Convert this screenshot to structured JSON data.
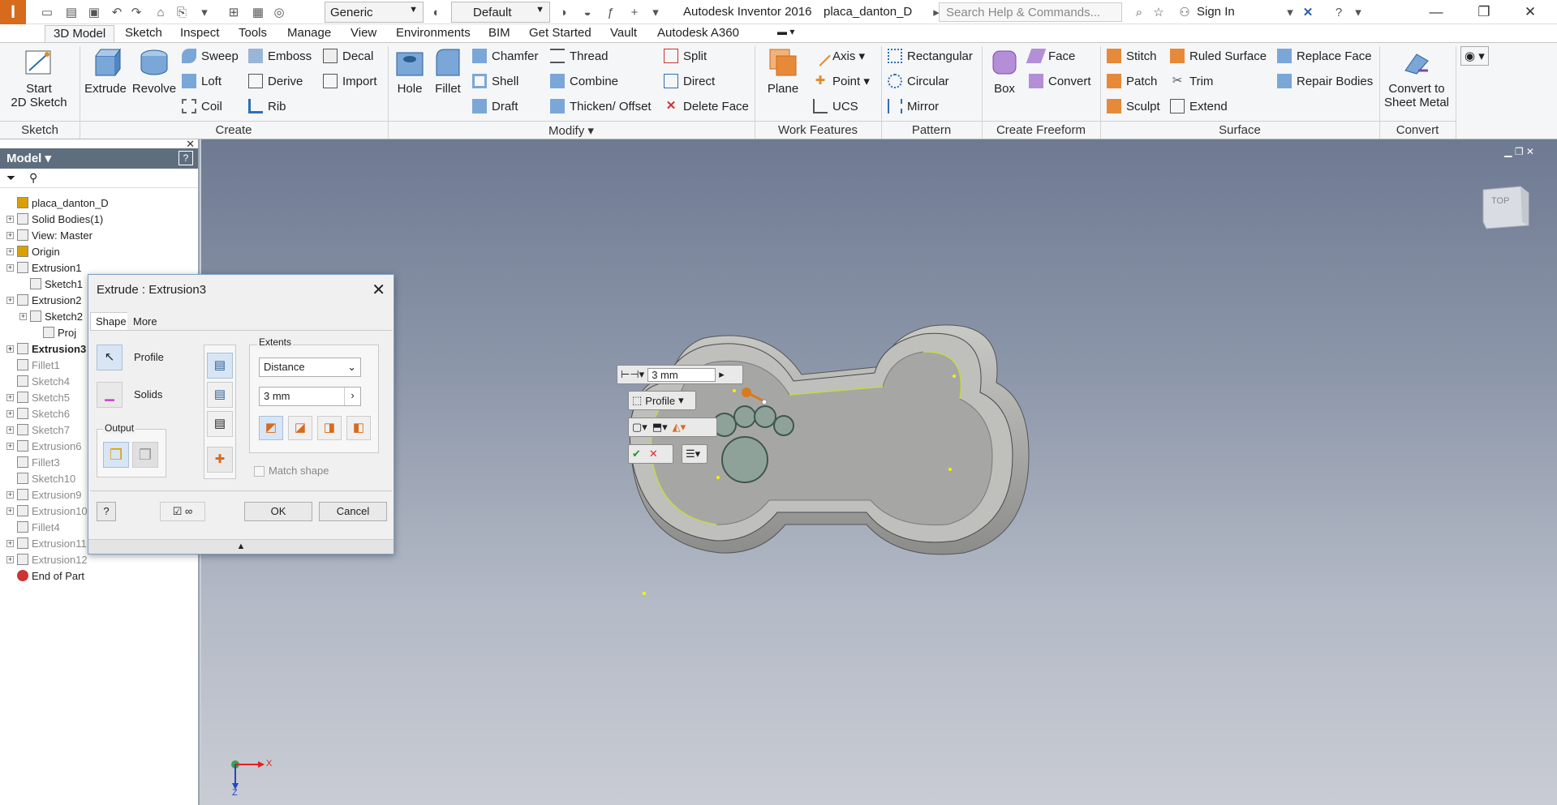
{
  "app": {
    "title": "Autodesk Inventor 2016",
    "document": "placa_danton_D",
    "search_placeholder": "Search Help & Commands...",
    "sign_in": "Sign In",
    "material_select": "Generic",
    "appearance_select": "Default"
  },
  "ribbon_tabs": [
    "3D Model",
    "Sketch",
    "Inspect",
    "Tools",
    "Manage",
    "View",
    "Environments",
    "BIM",
    "Get Started",
    "Vault",
    "Autodesk A360"
  ],
  "ribbon": {
    "sketch": {
      "start_sketch_line1": "Start",
      "start_sketch_line2": "2D Sketch",
      "panel": "Sketch"
    },
    "create": {
      "extrude": "Extrude",
      "revolve": "Revolve",
      "sweep": "Sweep",
      "loft": "Loft",
      "coil": "Coil",
      "emboss": "Emboss",
      "derive": "Derive",
      "rib": "Rib",
      "decal": "Decal",
      "import": "Import",
      "panel": "Create"
    },
    "modify": {
      "hole": "Hole",
      "fillet": "Fillet",
      "chamfer": "Chamfer",
      "shell": "Shell",
      "draft": "Draft",
      "thread": "Thread",
      "combine": "Combine",
      "thicken": "Thicken/ Offset",
      "split": "Split",
      "direct": "Direct",
      "delete_face": "Delete Face",
      "panel": "Modify"
    },
    "work_features": {
      "plane": "Plane",
      "axis": "Axis",
      "point": "Point",
      "ucs": "UCS",
      "panel": "Work Features"
    },
    "pattern": {
      "rectangular": "Rectangular",
      "circular": "Circular",
      "mirror": "Mirror",
      "panel": "Pattern"
    },
    "freeform": {
      "box": "Box",
      "face": "Face",
      "convert": "Convert",
      "panel": "Create Freeform"
    },
    "surface": {
      "stitch": "Stitch",
      "patch": "Patch",
      "sculpt": "Sculpt",
      "ruled_surface": "Ruled Surface",
      "trim": "Trim",
      "extend": "Extend",
      "replace_face": "Replace Face",
      "repair_bodies": "Repair Bodies",
      "panel": "Surface"
    },
    "convert": {
      "line1": "Convert to",
      "line2": "Sheet Metal",
      "panel": "Convert"
    }
  },
  "browser": {
    "title": "Model",
    "nodes": [
      {
        "label": "placa_danton_D",
        "style": "normal"
      },
      {
        "label": "Solid Bodies(1)",
        "style": "normal"
      },
      {
        "label": "View: Master",
        "style": "normal"
      },
      {
        "label": "Origin",
        "style": "normal"
      },
      {
        "label": "Extrusion1",
        "style": "normal"
      },
      {
        "label": "Sketch1",
        "style": "normal"
      },
      {
        "label": "Extrusion2",
        "style": "normal"
      },
      {
        "label": "Sketch2",
        "style": "normal"
      },
      {
        "label": "Proj",
        "style": "normal"
      },
      {
        "label": "Extrusion3",
        "style": "bold"
      },
      {
        "label": "Fillet1",
        "style": "grey"
      },
      {
        "label": "Sketch4",
        "style": "grey"
      },
      {
        "label": "Sketch5",
        "style": "grey"
      },
      {
        "label": "Sketch6",
        "style": "grey"
      },
      {
        "label": "Sketch7",
        "style": "grey"
      },
      {
        "label": "Extrusion6",
        "style": "grey"
      },
      {
        "label": "Fillet3",
        "style": "grey"
      },
      {
        "label": "Sketch10",
        "style": "grey"
      },
      {
        "label": "Extrusion9",
        "style": "grey"
      },
      {
        "label": "Extrusion10",
        "style": "grey"
      },
      {
        "label": "Fillet4",
        "style": "grey"
      },
      {
        "label": "Extrusion11",
        "style": "grey"
      },
      {
        "label": "Extrusion12",
        "style": "grey"
      },
      {
        "label": "End of Part",
        "style": "normal"
      }
    ]
  },
  "dialog": {
    "title": "Extrude : Extrusion3",
    "tab_shape": "Shape",
    "tab_more": "More",
    "profile": "Profile",
    "solids": "Solids",
    "output": "Output",
    "extents": "Extents",
    "extent_type": "Distance",
    "distance": "3 mm",
    "match_shape": "Match shape",
    "ok": "OK",
    "cancel": "Cancel"
  },
  "minitoolbar": {
    "distance": "3 mm",
    "profile": "Profile"
  },
  "viewcube": {
    "label": "TOP"
  },
  "triad": {
    "x": "X",
    "z": "Z"
  }
}
